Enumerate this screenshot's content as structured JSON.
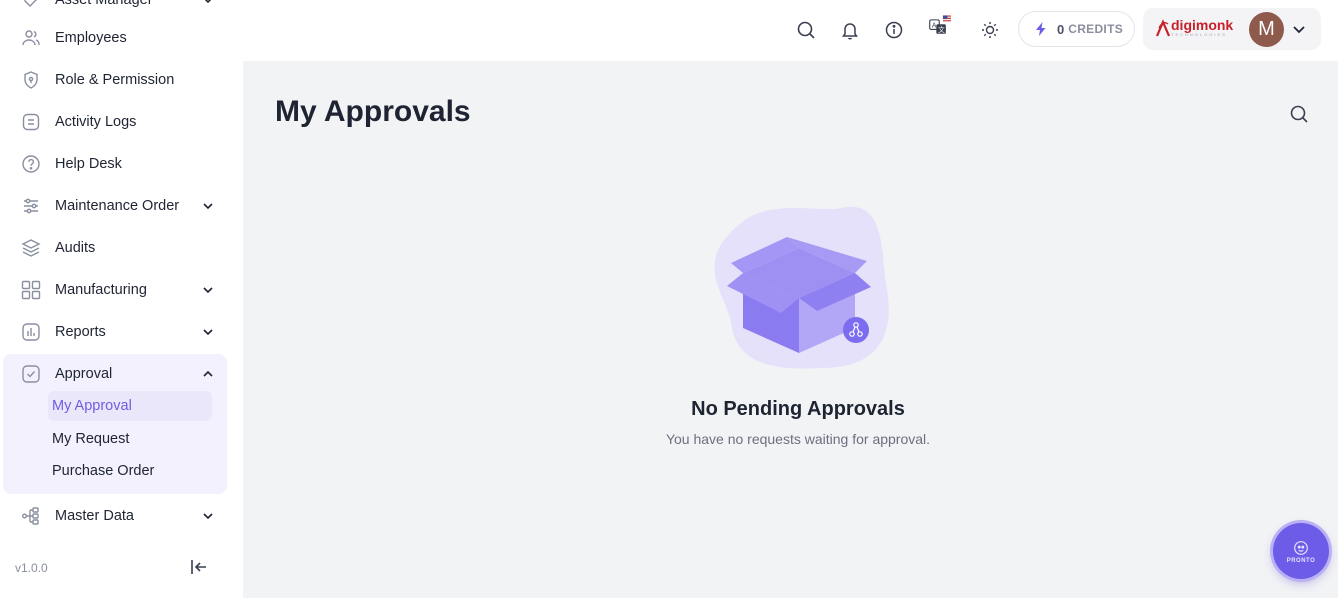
{
  "sidebar": {
    "partial_top_label": "Asset Manager",
    "items": [
      {
        "label": "Employees"
      },
      {
        "label": "Role & Permission"
      },
      {
        "label": "Activity Logs"
      },
      {
        "label": "Help Desk"
      },
      {
        "label": "Maintenance Order"
      },
      {
        "label": "Audits"
      },
      {
        "label": "Manufacturing"
      },
      {
        "label": "Reports"
      },
      {
        "label": "Approval"
      },
      {
        "label": "Master Data"
      }
    ],
    "approval_sub": [
      {
        "label": "My Approval"
      },
      {
        "label": "My Request"
      },
      {
        "label": "Purchase Order"
      }
    ],
    "version": "v1.0.0"
  },
  "header": {
    "credits_count": "0",
    "credits_label": "CREDITS",
    "brand_name": "digimonk",
    "brand_tagline": "TECHNOLOGIES",
    "avatar_initial": "M"
  },
  "main": {
    "title": "My Approvals",
    "empty_title": "No Pending Approvals",
    "empty_desc": "You have no requests waiting for approval."
  },
  "fab": {
    "label": "PRONTO"
  },
  "colors": {
    "accent": "#6c5ce7",
    "active_bg": "#ebe7fb",
    "main_bg": "#f2f3f5"
  }
}
